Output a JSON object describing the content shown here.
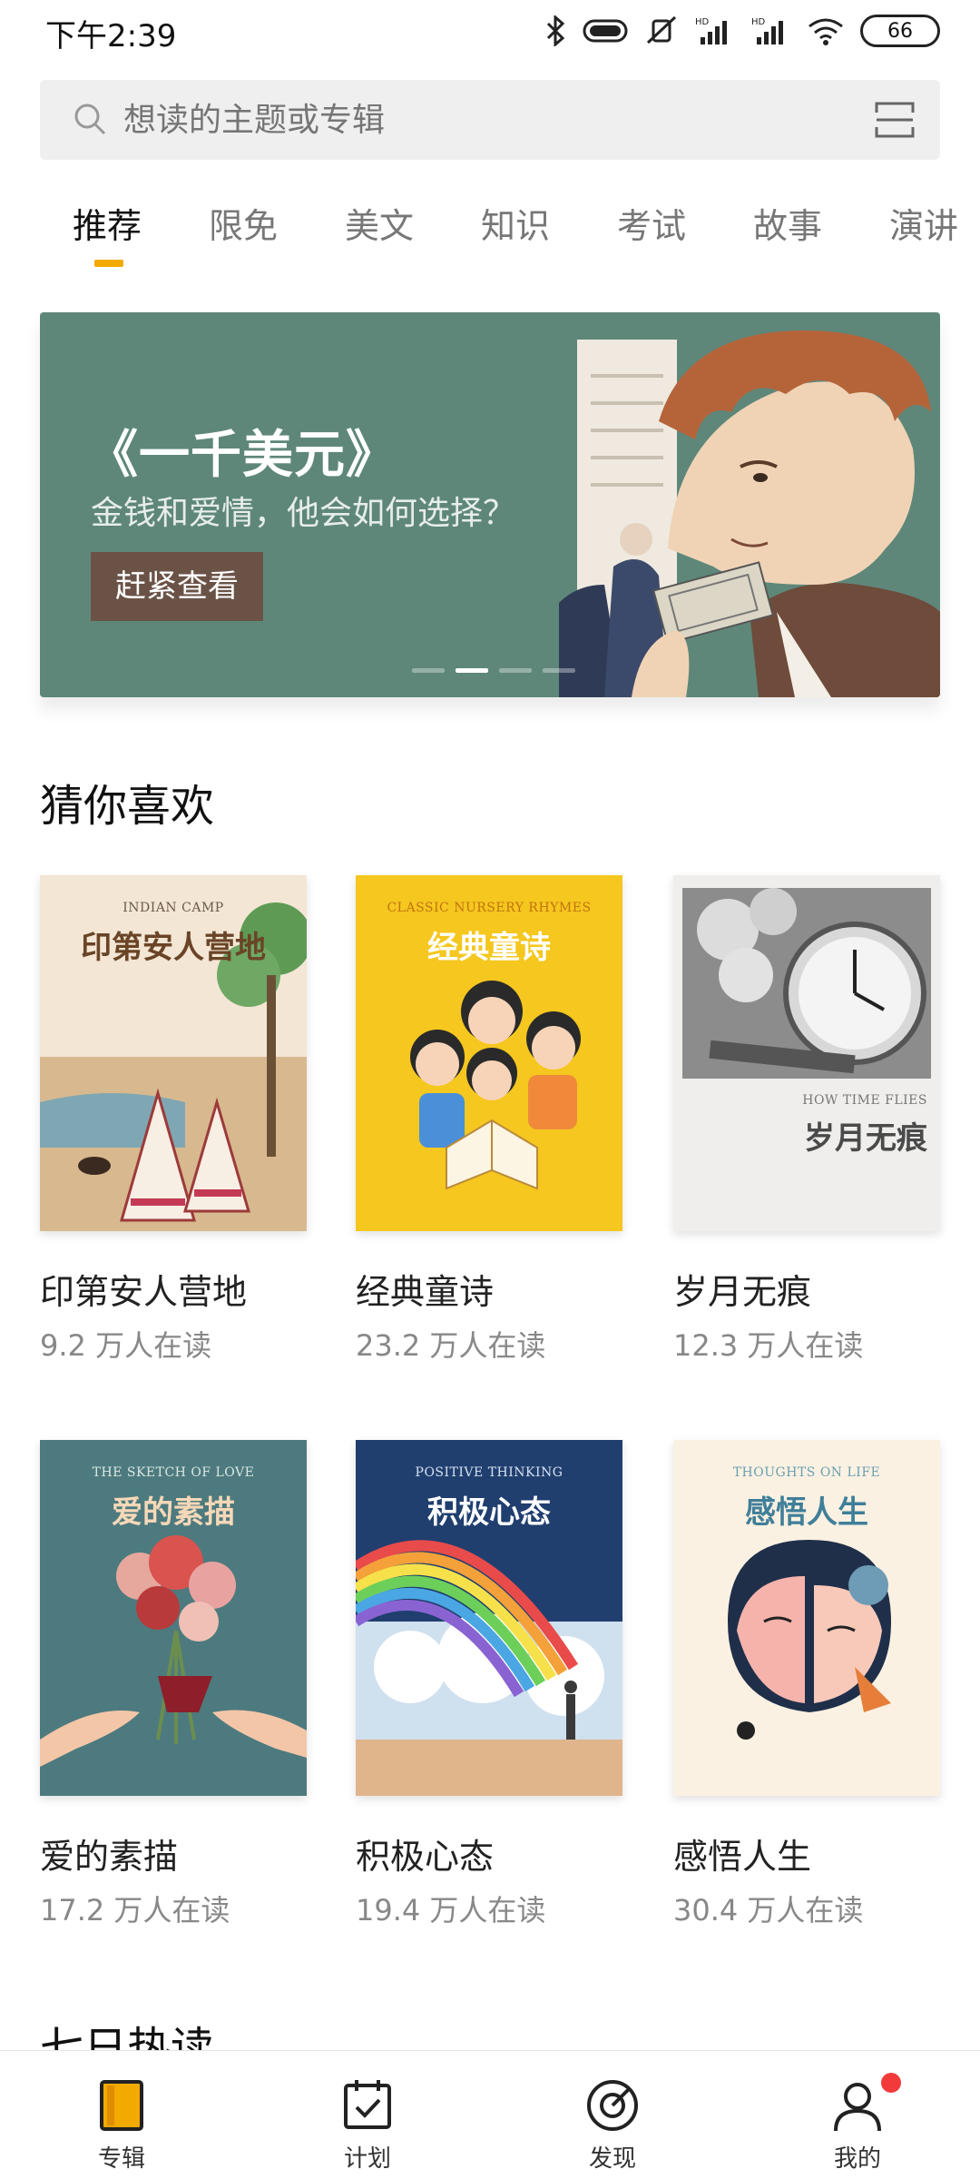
{
  "status_bar": {
    "time": "下午2:39",
    "battery": "66"
  },
  "search": {
    "placeholder": "想读的主题或专辑"
  },
  "tabs": [
    {
      "label": "推荐",
      "active": true
    },
    {
      "label": "限免"
    },
    {
      "label": "美文"
    },
    {
      "label": "知识"
    },
    {
      "label": "考试"
    },
    {
      "label": "故事"
    },
    {
      "label": "演讲"
    }
  ],
  "banner": {
    "title": "《一千美元》",
    "subtitle": "金钱和爱情，他会如何选择？",
    "button": "赶紧查看",
    "color": "#5e877a"
  },
  "section_guess": {
    "title": "猜你喜欢"
  },
  "books": [
    {
      "title": "印第安人营地",
      "readers": "9.2 万人在读",
      "cover_en": "INDIAN CAMP",
      "cover_cn": "印第安人营地"
    },
    {
      "title": "经典童诗",
      "readers": "23.2 万人在读",
      "cover_en": "CLASSIC NURSERY RHYMES",
      "cover_cn": "经典童诗"
    },
    {
      "title": "岁月无痕",
      "readers": "12.3 万人在读",
      "cover_en": "HOW TIME FLIES",
      "cover_cn": "岁月无痕"
    },
    {
      "title": "爱的素描",
      "readers": "17.2 万人在读",
      "cover_en": "THE SKETCH OF LOVE",
      "cover_cn": "爱的素描"
    },
    {
      "title": "积极心态",
      "readers": "19.4 万人在读",
      "cover_en": "POSITIVE THINKING",
      "cover_cn": "积极心态"
    },
    {
      "title": "感悟人生",
      "readers": "30.4 万人在读",
      "cover_en": "THOUGHTS ON LIFE",
      "cover_cn": "感悟人生"
    }
  ],
  "section_weekly": {
    "title": "七日热读"
  },
  "bottom_nav": [
    {
      "label": "专辑",
      "icon": "album-icon",
      "active": true
    },
    {
      "label": "计划",
      "icon": "calendar-check-icon"
    },
    {
      "label": "发现",
      "icon": "target-icon"
    },
    {
      "label": "我的",
      "icon": "user-icon",
      "badge": true
    }
  ],
  "colors": {
    "accent": "#f2a900",
    "badge": "#f23a3a"
  }
}
